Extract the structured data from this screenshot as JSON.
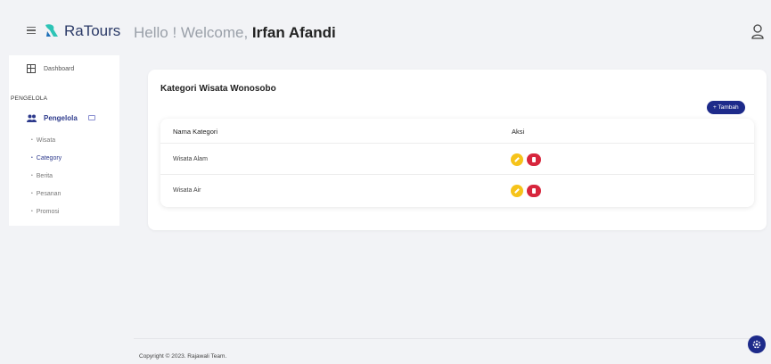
{
  "header": {
    "brand": "RaTours",
    "welcome_prefix": "Hello ! Welcome, ",
    "user_name": "Irfan Afandi"
  },
  "sidebar": {
    "dashboard_label": "Dashboard",
    "section_label": "PENGELOLA",
    "group_label": "Pengelola",
    "items": [
      {
        "label": "Wisata"
      },
      {
        "label": "Category"
      },
      {
        "label": "Berita"
      },
      {
        "label": "Pesanan"
      },
      {
        "label": "Promosi"
      }
    ]
  },
  "main": {
    "card_title": "Kategori Wisata Wonosobo",
    "add_button_label": "+ Tambah",
    "table": {
      "columns": [
        "Nama Kategori",
        "Aksi"
      ],
      "rows": [
        {
          "name": "Wisata Alam"
        },
        {
          "name": "Wisata Air"
        }
      ]
    }
  },
  "footer": {
    "copyright": "Copyright © 2023. Rajawali Team."
  },
  "colors": {
    "accent": "#1d2a8a",
    "edit": "#f6c31a",
    "delete": "#d7263d"
  }
}
